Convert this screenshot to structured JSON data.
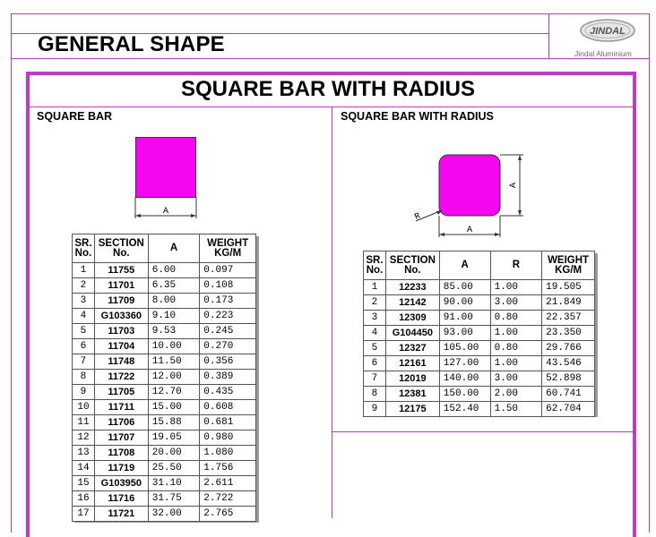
{
  "header": {
    "title": "GENERAL SHAPE",
    "logo_text": "JINDAL",
    "logo_caption": "Jindal Aluminium"
  },
  "main_title": "SQUARE BAR WITH RADIUS",
  "colors": {
    "accent": "#c03ac8",
    "shape_fill": "#f407f0"
  },
  "left": {
    "title": "SQUARE BAR",
    "dim_label": "A",
    "table": {
      "headers": [
        "SR. No.",
        "SECTION No.",
        "A",
        "WEIGHT KG/M"
      ],
      "rows": [
        [
          "1",
          "11755",
          "6.00",
          "0.097"
        ],
        [
          "2",
          "11701",
          "6.35",
          "0.108"
        ],
        [
          "3",
          "11709",
          "8.00",
          "0.173"
        ],
        [
          "4",
          "G103360",
          "9.10",
          "0.223"
        ],
        [
          "5",
          "11703",
          "9.53",
          "0.245"
        ],
        [
          "6",
          "11704",
          "10.00",
          "0.270"
        ],
        [
          "7",
          "11748",
          "11.50",
          "0.356"
        ],
        [
          "8",
          "11722",
          "12.00",
          "0.389"
        ],
        [
          "9",
          "11705",
          "12.70",
          "0.435"
        ],
        [
          "10",
          "11711",
          "15.00",
          "0.608"
        ],
        [
          "11",
          "11706",
          "15.88",
          "0.681"
        ],
        [
          "12",
          "11707",
          "19.05",
          "0.980"
        ],
        [
          "13",
          "11708",
          "20.00",
          "1.080"
        ],
        [
          "14",
          "11719",
          "25.50",
          "1.756"
        ],
        [
          "15",
          "G103950",
          "31.10",
          "2.611"
        ],
        [
          "16",
          "11716",
          "31.75",
          "2.722"
        ],
        [
          "17",
          "11721",
          "32.00",
          "2.765"
        ]
      ]
    }
  },
  "right": {
    "title": "SQUARE BAR WITH RADIUS",
    "dim_label_a_bottom": "A",
    "dim_label_a_side": "A",
    "dim_label_r": "R",
    "table": {
      "headers": [
        "SR. No.",
        "SECTION No.",
        "A",
        "R",
        "WEIGHT KG/M"
      ],
      "rows": [
        [
          "1",
          "12233",
          "85.00",
          "1.00",
          "19.505"
        ],
        [
          "2",
          "12142",
          "90.00",
          "3.00",
          "21.849"
        ],
        [
          "3",
          "12309",
          "91.00",
          "0.80",
          "22.357"
        ],
        [
          "4",
          "G104450",
          "93.00",
          "1.00",
          "23.350"
        ],
        [
          "5",
          "12327",
          "105.00",
          "0.80",
          "29.766"
        ],
        [
          "6",
          "12161",
          "127.00",
          "1.00",
          "43.546"
        ],
        [
          "7",
          "12019",
          "140.00",
          "3.00",
          "52.898"
        ],
        [
          "8",
          "12381",
          "150.00",
          "2.00",
          "60.741"
        ],
        [
          "9",
          "12175",
          "152.40",
          "1.50",
          "62.704"
        ]
      ]
    }
  }
}
